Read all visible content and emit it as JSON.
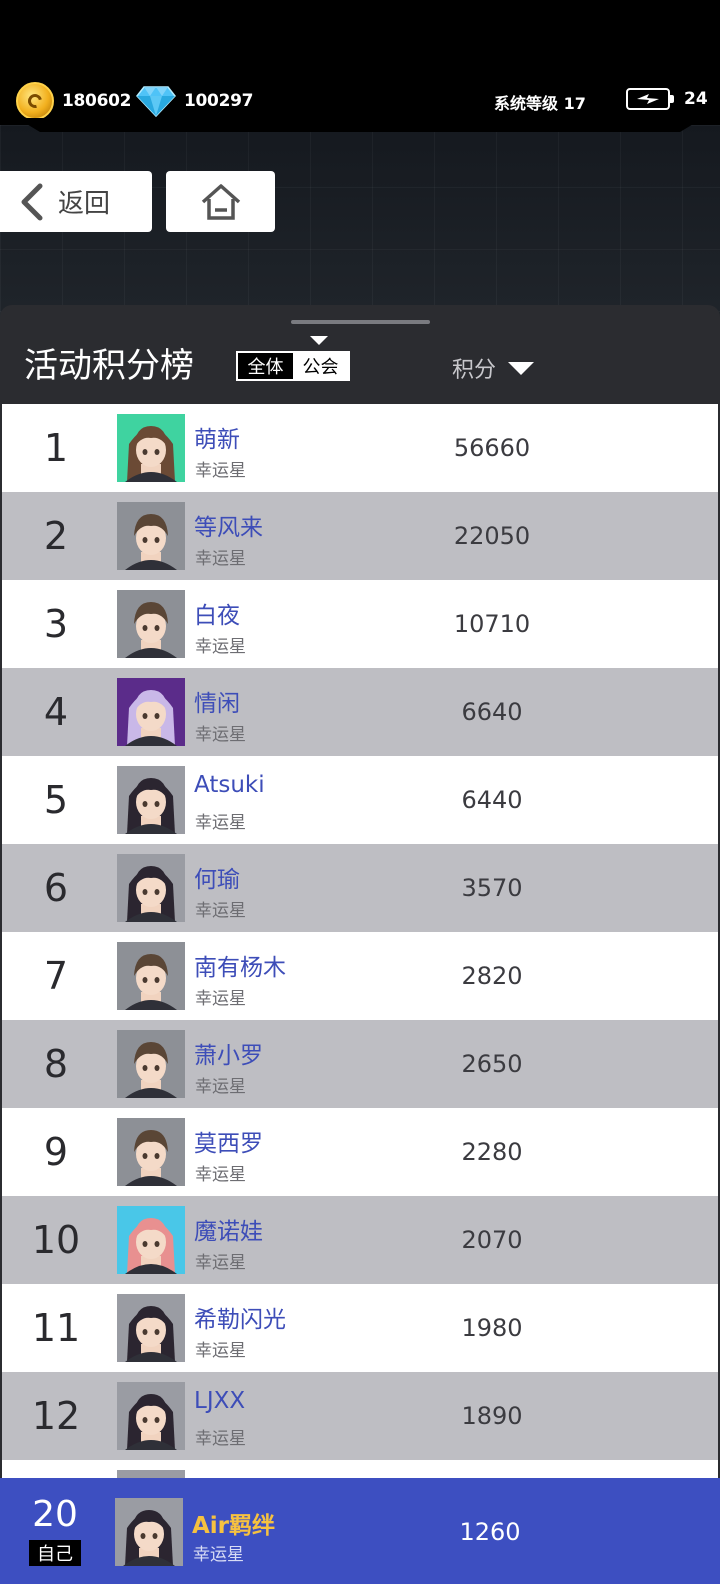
{
  "status": {
    "coins": "180602",
    "diamonds": "100297",
    "system_level": "系统等级 17",
    "energy": "24"
  },
  "nav": {
    "back_label": "返回"
  },
  "board": {
    "title": "活动积分榜",
    "scope_options": [
      "全体",
      "公会"
    ],
    "score_label": "积分"
  },
  "rows": [
    {
      "rank": "1",
      "name": "萌新",
      "title": "幸运星",
      "score": "56660",
      "avatar": "girl-green"
    },
    {
      "rank": "2",
      "name": "等风来",
      "title": "幸运星",
      "score": "22050",
      "avatar": "boy"
    },
    {
      "rank": "3",
      "name": "白夜",
      "title": "幸运星",
      "score": "10710",
      "avatar": "boy"
    },
    {
      "rank": "4",
      "name": "情闲",
      "title": "幸运星",
      "score": "6640",
      "avatar": "girl-purple"
    },
    {
      "rank": "5",
      "name": "Atsuki",
      "title": "幸运星",
      "score": "6440",
      "avatar": "girl-dark"
    },
    {
      "rank": "6",
      "name": "何瑜",
      "title": "幸运星",
      "score": "3570",
      "avatar": "girl-dark"
    },
    {
      "rank": "7",
      "name": "南有杨木",
      "title": "幸运星",
      "score": "2820",
      "avatar": "boy"
    },
    {
      "rank": "8",
      "name": "萧小罗",
      "title": "幸运星",
      "score": "2650",
      "avatar": "boy"
    },
    {
      "rank": "9",
      "name": "莫西罗",
      "title": "幸运星",
      "score": "2280",
      "avatar": "boy"
    },
    {
      "rank": "10",
      "name": "魔诺娃",
      "title": "幸运星",
      "score": "2070",
      "avatar": "girl-pink"
    },
    {
      "rank": "11",
      "name": "希勒闪光",
      "title": "幸运星",
      "score": "1980",
      "avatar": "girl-dark"
    },
    {
      "rank": "12",
      "name": "LJXX",
      "title": "幸运星",
      "score": "1890",
      "avatar": "girl-dark"
    },
    {
      "rank": "",
      "name": "",
      "title": "",
      "score": "",
      "avatar": "girl-dark"
    }
  ],
  "self": {
    "rank": "20",
    "tag": "自己",
    "name": "Air羁绊",
    "title": "幸运星",
    "score": "1260",
    "avatar": "girl-dark"
  },
  "colors": {
    "accent": "#3d4fc1",
    "name": "#3d4db8",
    "self_name": "#f6c140",
    "row_alt": "#bebec3",
    "panel": "#2b2c30"
  }
}
